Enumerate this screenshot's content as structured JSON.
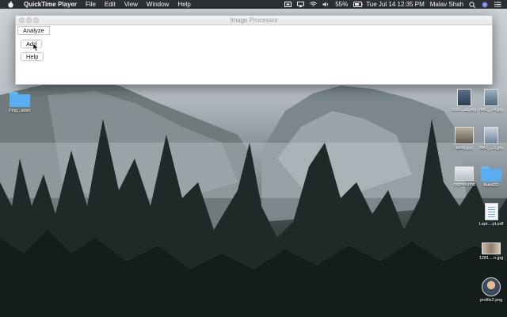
{
  "menubar": {
    "app_name": "QuickTime Player",
    "menus": [
      "File",
      "Edit",
      "View",
      "Window",
      "Help"
    ],
    "battery": "55%",
    "datetime": "Tue Jul 14  12:35 PM",
    "user": "Malav Shah"
  },
  "window": {
    "title": "Image Processor",
    "buttons": {
      "analyze": "Analyze",
      "add": "Add",
      "help": "Help"
    }
  },
  "desktop": {
    "icons": [
      {
        "label": "Fing...aster",
        "kind": "folder"
      },
      {
        "label": "Scre...at.png",
        "kind": "image"
      },
      {
        "label": "IMG_...4.jpg",
        "kind": "image"
      },
      {
        "label": "temp.jpg",
        "kind": "image"
      },
      {
        "label": "IMG_...2.jpg",
        "kind": "image"
      },
      {
        "label": "cygnus.png",
        "kind": "image"
      },
      {
        "label": "AutoDD",
        "kind": "folder"
      },
      {
        "label": "Lapt....pt.pdf",
        "kind": "pdf"
      },
      {
        "label": "1281....n.jpg",
        "kind": "image"
      },
      {
        "label": "profile2.png",
        "kind": "image"
      }
    ]
  },
  "colors": {
    "menubar": "#2d3033",
    "folder": "#58aef0"
  }
}
